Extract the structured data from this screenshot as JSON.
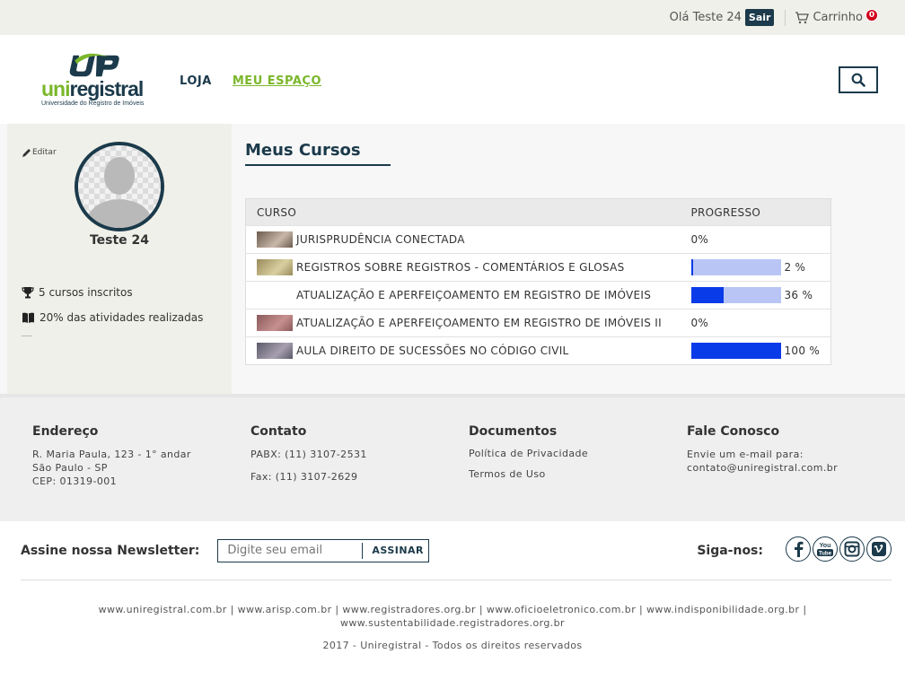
{
  "topbar": {
    "greeting": "Olá Teste 24",
    "logout_label": "Sair",
    "cart_label": "Carrinho",
    "cart_count": "0"
  },
  "header": {
    "logo_uni": "uni",
    "logo_registral": "registral",
    "logo_subtitle": "Universidade do Registro de Imóveis",
    "nav": [
      {
        "label": "LOJA"
      },
      {
        "label": "MEU ESPAÇO"
      }
    ],
    "search_icon": "search-icon"
  },
  "sidebar": {
    "edit_label": "Editar",
    "user_name": "Teste 24",
    "stats": [
      {
        "icon": "trophy-icon",
        "text": "5 cursos inscritos"
      },
      {
        "icon": "book-icon",
        "text": "20% das atividades realizadas"
      }
    ]
  },
  "courses": {
    "title": "Meus Cursos",
    "columns": [
      "CURSO",
      "PROGRESSO"
    ],
    "rows": [
      {
        "name": "JURISPRUDÊNCIA CONECTADA",
        "progress_text": "0%",
        "progress": 0,
        "has_bar": false,
        "thumb": "photo-thumbnail"
      },
      {
        "name": "REGISTROS SOBRE REGISTROS - COMENTÁRIOS E GLOSAS",
        "progress_text": "2 %",
        "progress": 2,
        "has_bar": true,
        "thumb": "photo-thumbnail"
      },
      {
        "name": "ATUALIZAÇÃO E APERFEIÇOAMENTO EM REGISTRO DE IMÓVEIS",
        "progress_text": "36 %",
        "progress": 36,
        "has_bar": true,
        "thumb": ""
      },
      {
        "name": "ATUALIZAÇÃO E APERFEIÇOAMENTO EM REGISTRO DE IMÓVEIS II",
        "progress_text": "0%",
        "progress": 0,
        "has_bar": false,
        "thumb": "photo-thumbnail"
      },
      {
        "name": "AULA DIREITO DE SUCESSÕES NO CÓDIGO CIVIL",
        "progress_text": "100 %",
        "progress": 100,
        "has_bar": true,
        "thumb": "photo-thumbnail"
      }
    ]
  },
  "footer": {
    "address": {
      "title": "Endereço",
      "line1": "R. Maria Paula, 123 - 1° andar",
      "line2": "São Paulo - SP",
      "line3": "CEP: 01319-001"
    },
    "contact": {
      "title": "Contato",
      "phone": "PABX: (11) 3107-2531",
      "fax": "Fax: (11) 3107-2629"
    },
    "documents": {
      "title": "Documentos",
      "privacy": "Política de Privacidade",
      "terms": "Termos de Uso"
    },
    "talk": {
      "title": "Fale Conosco",
      "line1": "Envie um e-mail para:",
      "email": "contato@uniregistral.com.br"
    },
    "newsletter": {
      "label": "Assine nossa Newsletter:",
      "placeholder": "Digite seu email",
      "button": "ASSINAR"
    },
    "follow_label": "Siga-nos:",
    "socials": [
      "facebook-icon",
      "youtube-icon",
      "instagram-icon",
      "vimeo-icon"
    ],
    "links": [
      "www.uniregistral.com.br",
      "www.arisp.com.br",
      "www.registradores.org.br",
      "www.oficioeletronico.com.br",
      "www.indisponibilidade.org.br",
      "www.sustentabilidade.registradores.org.br"
    ],
    "copyright": "2017 - Uniregistral - Todos os direitos reservados"
  },
  "colors": {
    "brand_dark": "#1b3a4b",
    "brand_green": "#7bb72b",
    "progress_fill": "#0a3be8",
    "progress_track": "#b9c6f5"
  }
}
